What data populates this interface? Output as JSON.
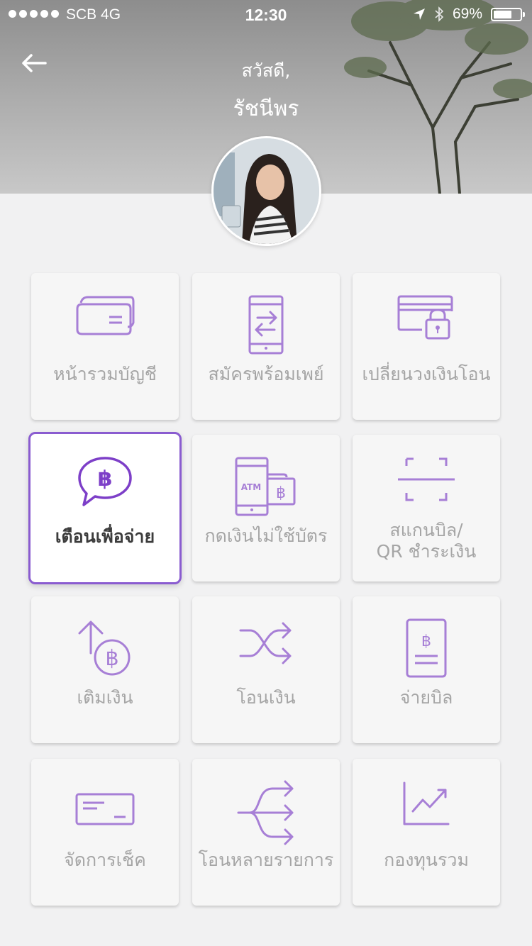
{
  "status_bar": {
    "carrier": "SCB 4G",
    "time": "12:30",
    "battery": "69%",
    "battery_level": 0.69
  },
  "header": {
    "greeting": "สวัสดี,",
    "name": "รัชนีพร"
  },
  "menu": {
    "items": [
      {
        "label": "หน้ารวมบัญชี",
        "icon": "cards-icon"
      },
      {
        "label": "สมัครพร้อมเพย์",
        "icon": "phone-transfer-icon"
      },
      {
        "label": "เปลี่ยนวงเงินโอน",
        "icon": "card-lock-icon"
      },
      {
        "label": "เตือนเพื่อจ่าย",
        "icon": "baht-chat-icon",
        "selected": true
      },
      {
        "label": "กดเงินไม่ใช้บัตร",
        "icon": "atm-phone-icon"
      },
      {
        "label": "สแกนบิล/\nQR ชำระเงิน",
        "line1": "สแกนบิล/",
        "line2": "QR ชำระเงิน",
        "icon": "scan-icon"
      },
      {
        "label": "เติมเงิน",
        "icon": "topup-icon"
      },
      {
        "label": "โอนเงิน",
        "icon": "transfer-arrows-icon"
      },
      {
        "label": "จ่ายบิล",
        "icon": "bill-icon"
      },
      {
        "label": "จัดการเช็ค",
        "icon": "cheque-icon"
      },
      {
        "label": "โอนหลายรายการ",
        "icon": "multi-transfer-icon"
      },
      {
        "label": "กองทุนรวม",
        "icon": "fund-chart-icon"
      }
    ]
  },
  "colors": {
    "accent": "#8a5cd0",
    "icon": "#a77fd6",
    "label": "#a5a5a5"
  }
}
